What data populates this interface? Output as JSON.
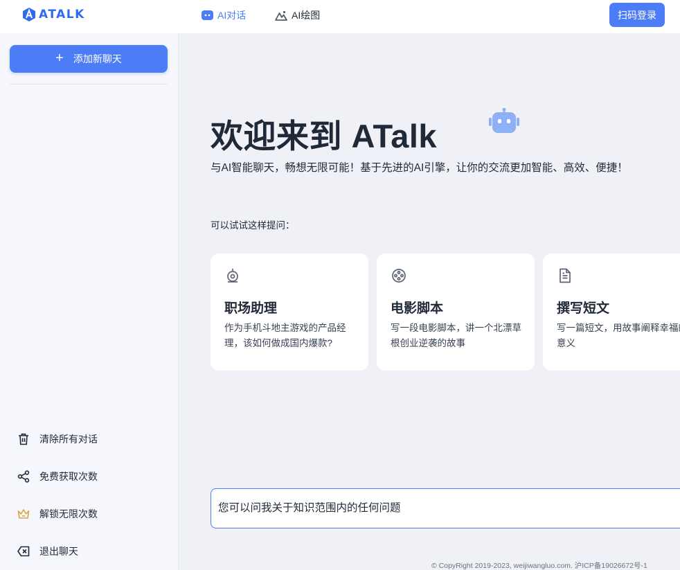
{
  "header": {
    "logo_text": "ATALK",
    "nav": [
      {
        "label": "AI对话",
        "icon": "chat-bubble-icon",
        "active": true
      },
      {
        "label": "AI绘图",
        "icon": "mountain-image-icon",
        "active": false
      }
    ],
    "login_label": "扫码登录"
  },
  "sidebar": {
    "new_chat_label": "添加新聊天",
    "actions": [
      {
        "label": "清除所有对话",
        "icon": "trash-icon"
      },
      {
        "label": "免费获取次数",
        "icon": "share-icon"
      },
      {
        "label": "解锁无限次数",
        "icon": "crown-icon"
      },
      {
        "label": "退出聊天",
        "icon": "backspace-icon"
      }
    ]
  },
  "main": {
    "title": "欢迎来到 ATalk",
    "subtitle": "与AI智能聊天，畅想无限可能！基于先进的AI引擎，让你的交流更加智能、高效、便捷！",
    "try_label": "可以试试这样提问：",
    "cards": [
      {
        "title": "职场助理",
        "desc": "作为手机斗地主游戏的产品经理，该如何做成国内爆款?",
        "icon": "webcam-icon"
      },
      {
        "title": "电影脚本",
        "desc": "写一段电影脚本，讲一个北漂草根创业逆袭的故事",
        "icon": "film-reel-icon"
      },
      {
        "title": "撰写短文",
        "desc": "写一篇短文，用故事阐释幸福的意义",
        "icon": "document-icon"
      }
    ],
    "input_placeholder": "您可以问我关于知识范围内的任何问题",
    "footer": "© CopyRight 2019-2023, weijiwangluo.com. 沪ICP备19026672号-1"
  },
  "colors": {
    "accent": "#4c7cf6",
    "background": "#eff1f6",
    "sidebar": "#f5f7fc",
    "crown": "#d9a441"
  }
}
